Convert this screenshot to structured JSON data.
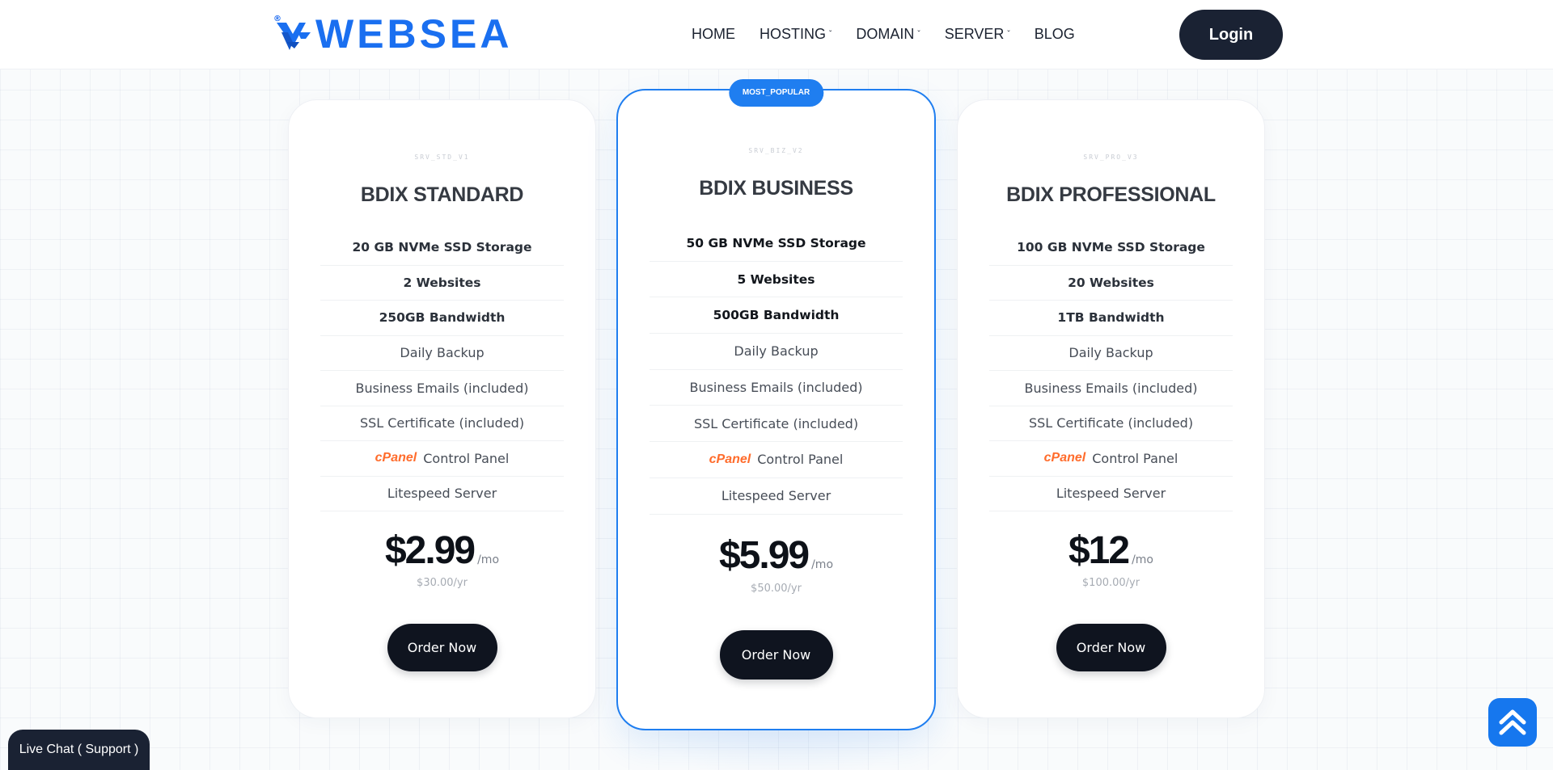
{
  "brand": {
    "name": "WEBSEA",
    "registered_mark": "®",
    "color": "#1a6ff0"
  },
  "nav": {
    "items": [
      {
        "label": "HOME",
        "has_dropdown": false
      },
      {
        "label": "HOSTING",
        "has_dropdown": true
      },
      {
        "label": "DOMAIN",
        "has_dropdown": true
      },
      {
        "label": "SERVER",
        "has_dropdown": true
      },
      {
        "label": "BLOG",
        "has_dropdown": false
      }
    ],
    "login_label": "Login"
  },
  "plans": [
    {
      "code": "SRV_STD_V1",
      "title": "BDIX STANDARD",
      "features": [
        "20 GB NVMe SSD Storage",
        "2 Websites",
        "250GB Bandwidth",
        "Daily Backup",
        "Business Emails (included)",
        "SSL Certificate (included)",
        "Control Panel",
        "Litespeed Server"
      ],
      "cpanel_label": "cPanel",
      "price": "$2.99",
      "per": "/mo",
      "yearly": "$30.00/yr",
      "order_label": "Order Now"
    },
    {
      "badge": "MOST_POPULAR",
      "code": "SRV_BIZ_V2",
      "title": "BDIX BUSINESS",
      "features": [
        "50 GB NVMe SSD Storage",
        "5 Websites",
        "500GB Bandwidth",
        "Daily Backup",
        "Business Emails (included)",
        "SSL Certificate (included)",
        "Control Panel",
        "Litespeed Server"
      ],
      "cpanel_label": "cPanel",
      "price": "$5.99",
      "per": "/mo",
      "yearly": "$50.00/yr",
      "order_label": "Order Now"
    },
    {
      "code": "SRV_PRO_V3",
      "title": "BDIX PROFESSIONAL",
      "features": [
        "100 GB NVMe SSD Storage",
        "20 Websites",
        "1TB Bandwidth",
        "Daily Backup",
        "Business Emails (included)",
        "SSL Certificate (included)",
        "Control Panel",
        "Litespeed Server"
      ],
      "cpanel_label": "cPanel",
      "price": "$12",
      "per": "/mo",
      "yearly": "$100.00/yr",
      "order_label": "Order Now"
    }
  ],
  "live_chat_label": "Live Chat ( Support )",
  "icons": {
    "logo": "websea-logo-icon",
    "chevron": "chevron-down-icon",
    "scroll_top": "double-chevron-up-icon"
  },
  "colors": {
    "accent": "#1f7ef0",
    "dark": "#0f141f",
    "cpanel": "#ff6c2c"
  }
}
